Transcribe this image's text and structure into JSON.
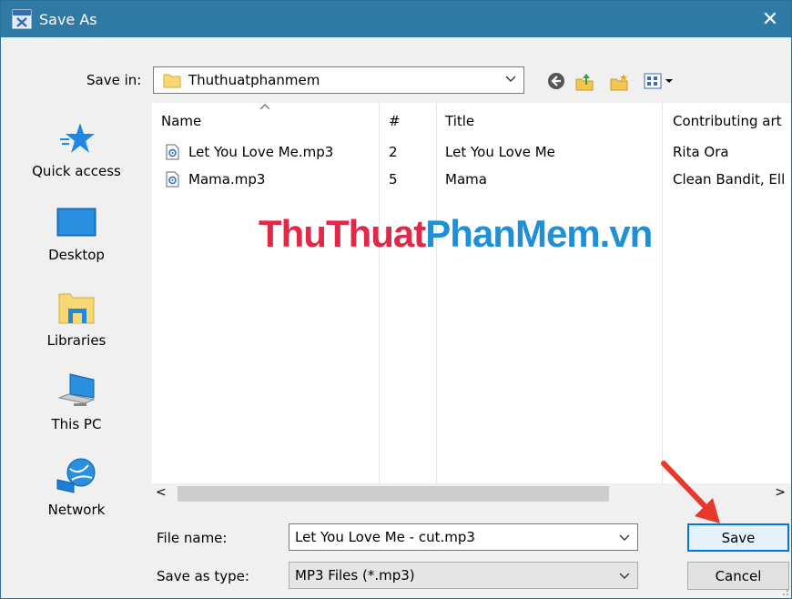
{
  "window": {
    "title": "Save As",
    "close_glyph": "✕",
    "title_icon": "mp3-app-icon"
  },
  "toolbar": {
    "save_in_label": "Save in:",
    "current_folder": "Thuthuatphanmem",
    "icons": [
      "back-icon",
      "up-folder-icon",
      "new-folder-icon",
      "view-menu-icon"
    ]
  },
  "places": [
    {
      "label": "Quick access",
      "icon": "star-icon"
    },
    {
      "label": "Desktop",
      "icon": "desktop-icon"
    },
    {
      "label": "Libraries",
      "icon": "libraries-icon"
    },
    {
      "label": "This PC",
      "icon": "computer-icon"
    },
    {
      "label": "Network",
      "icon": "network-icon"
    }
  ],
  "file_list": {
    "columns": [
      "Name",
      "#",
      "Title",
      "Contributing art"
    ],
    "rows": [
      {
        "name": "Let You Love Me.mp3",
        "num": "2",
        "title": "Let You Love Me",
        "artist": "Rita Ora"
      },
      {
        "name": "Mama.mp3",
        "num": "5",
        "title": "Mama",
        "artist": "Clean Bandit, Ell"
      }
    ],
    "scroll_left": "<",
    "scroll_right": ">"
  },
  "form": {
    "file_name_label": "File name:",
    "file_name_value": "Let You Love Me - cut.mp3",
    "save_type_label": "Save as type:",
    "save_type_value": "MP3 Files (*.mp3)"
  },
  "buttons": {
    "save": "Save",
    "cancel": "Cancel"
  },
  "watermark": {
    "part1": "ThuThuat",
    "part2": "PhanMem.vn"
  },
  "colors": {
    "titlebar": "#2f7aa5",
    "accent": "#0078d7",
    "annotation_arrow": "#e8382c"
  }
}
